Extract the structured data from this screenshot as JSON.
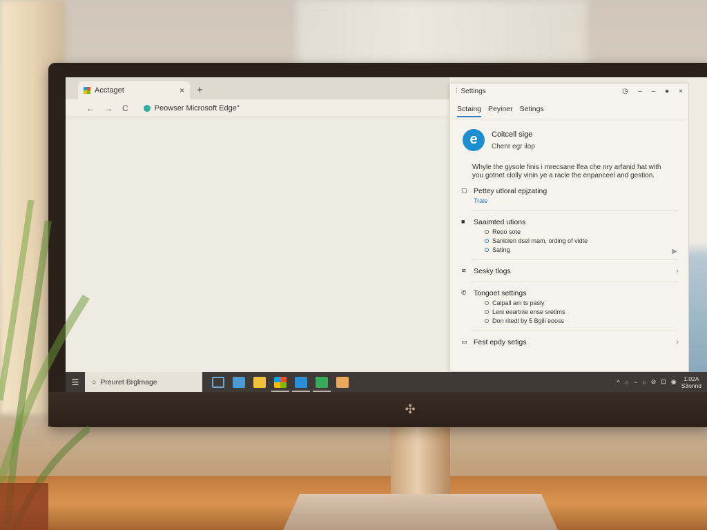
{
  "browser": {
    "tab_title": "Acctaget",
    "new_tab_label": "+",
    "close_tab_label": "×",
    "back_label": "←",
    "forward_label": "→",
    "refresh_label": "C",
    "address_text": "Peowser Microsoft Edge\""
  },
  "panel": {
    "title": "Settings",
    "window_controls": [
      "◷",
      "–",
      "–",
      "●",
      "×"
    ],
    "tabs": [
      {
        "label": "Sctaing",
        "active": true
      },
      {
        "label": "Peyiner",
        "active": false
      },
      {
        "label": "Setings",
        "active": false
      }
    ],
    "profile": {
      "name": "Coitcell sige",
      "subtitle": "Chenr egr ilop",
      "logo_glyph": "e"
    },
    "description": "Whyle the gysole finis i mrecsane lfea che nry arfanid hat with you gotnet clolly vinin ye a racle the enpanceel and gestion.",
    "sections": {
      "privacy": {
        "label": "Pettey utloral epjzating",
        "link": "Trale"
      },
      "saved": {
        "label": "Saaimted utions",
        "options": [
          "Reoo sote",
          "Sanlolen dsel mam, ording of vidte",
          "Sating"
        ]
      },
      "sky": {
        "label": "Sesky tlogs"
      },
      "tongue": {
        "label": "Tongoet settings",
        "options": [
          "Calpall am ts pasly",
          "Leni eeartnie ense sretims",
          "Don ritedl by 5 Bgili eooss"
        ]
      },
      "fest": {
        "label": "Fest epdy setigs"
      }
    }
  },
  "taskbar": {
    "start_glyph": "☰",
    "search_text": "Preuret Brglmage",
    "tray_icons": [
      "^",
      "∩",
      "~",
      "○",
      "⊘",
      "⊡",
      "◉"
    ],
    "clock_time": "1:02A",
    "clock_date": "S3onnd"
  },
  "colors": {
    "accent": "#2b7dbf",
    "taskbar": "#3f3a35",
    "edge_blue": "#1c8fd0"
  }
}
